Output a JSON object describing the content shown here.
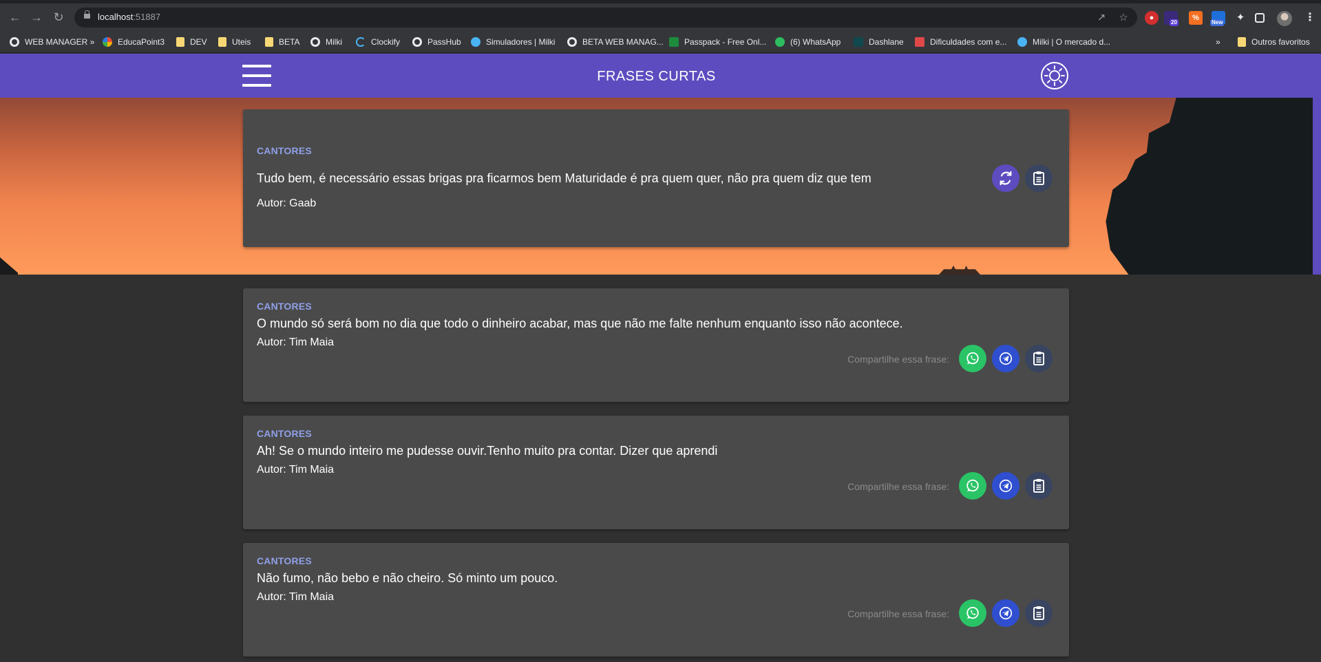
{
  "browser": {
    "url_host": "localhost",
    "url_port": ":51887",
    "extension_badges": {
      "ext2": "20",
      "ext4": "New"
    },
    "bookmarks": [
      {
        "label": "WEB MANAGER »",
        "icon": "globe-icon"
      },
      {
        "label": "EducaPoint3",
        "icon": "educapoint-icon"
      },
      {
        "label": "DEV",
        "icon": "folder-icon"
      },
      {
        "label": "Uteis",
        "icon": "folder-icon"
      },
      {
        "label": "BETA",
        "icon": "folder-icon"
      },
      {
        "label": "Milki",
        "icon": "globe-icon"
      },
      {
        "label": "Clockify",
        "icon": "clockify-icon"
      },
      {
        "label": "PassHub",
        "icon": "globe-icon"
      },
      {
        "label": "Simuladores | Milki",
        "icon": "milki-icon"
      },
      {
        "label": "BETA WEB MANAG...",
        "icon": "globe-icon"
      },
      {
        "label": "Passpack - Free Onl...",
        "icon": "passpack-icon"
      },
      {
        "label": "(6) WhatsApp",
        "icon": "whatsapp-icon"
      },
      {
        "label": "Dashlane",
        "icon": "dashlane-icon"
      },
      {
        "label": "Dificuldades com e...",
        "icon": "dificuldades-icon"
      },
      {
        "label": "Milki | O mercado d...",
        "icon": "milki-icon"
      }
    ],
    "more_bookmarks": "»",
    "other_bookmarks": "Outros favoritos"
  },
  "app": {
    "title": "FRASES CURTAS",
    "accent_color": "#5d4cbf"
  },
  "featured": {
    "category": "CANTORES",
    "phrase": "Tudo bem, é necessário essas brigas pra ficarmos bem Maturidade é pra quem quer, não pra quem diz que tem",
    "author": "Autor: Gaab"
  },
  "phrases": [
    {
      "category": "CANTORES",
      "phrase": "O mundo só será bom no dia que todo o dinheiro acabar, mas que não me falte nenhum enquanto isso não acontece.",
      "author": "Autor: Tim Maia",
      "share_label": "Compartilhe essa frase:"
    },
    {
      "category": "CANTORES",
      "phrase": "Ah! Se o mundo inteiro me pudesse ouvir.Tenho muito pra contar. Dizer que aprendi",
      "author": "Autor: Tim Maia",
      "share_label": "Compartilhe essa frase:"
    },
    {
      "category": "CANTORES",
      "phrase": "Não fumo, não bebo e não cheiro. Só minto um pouco.",
      "author": "Autor: Tim Maia",
      "share_label": "Compartilhe essa frase:"
    }
  ],
  "colors": {
    "whatsapp": "#2ac466",
    "telegram": "#2f4fd0",
    "copy": "#384460",
    "category": "#8fa0e8"
  }
}
